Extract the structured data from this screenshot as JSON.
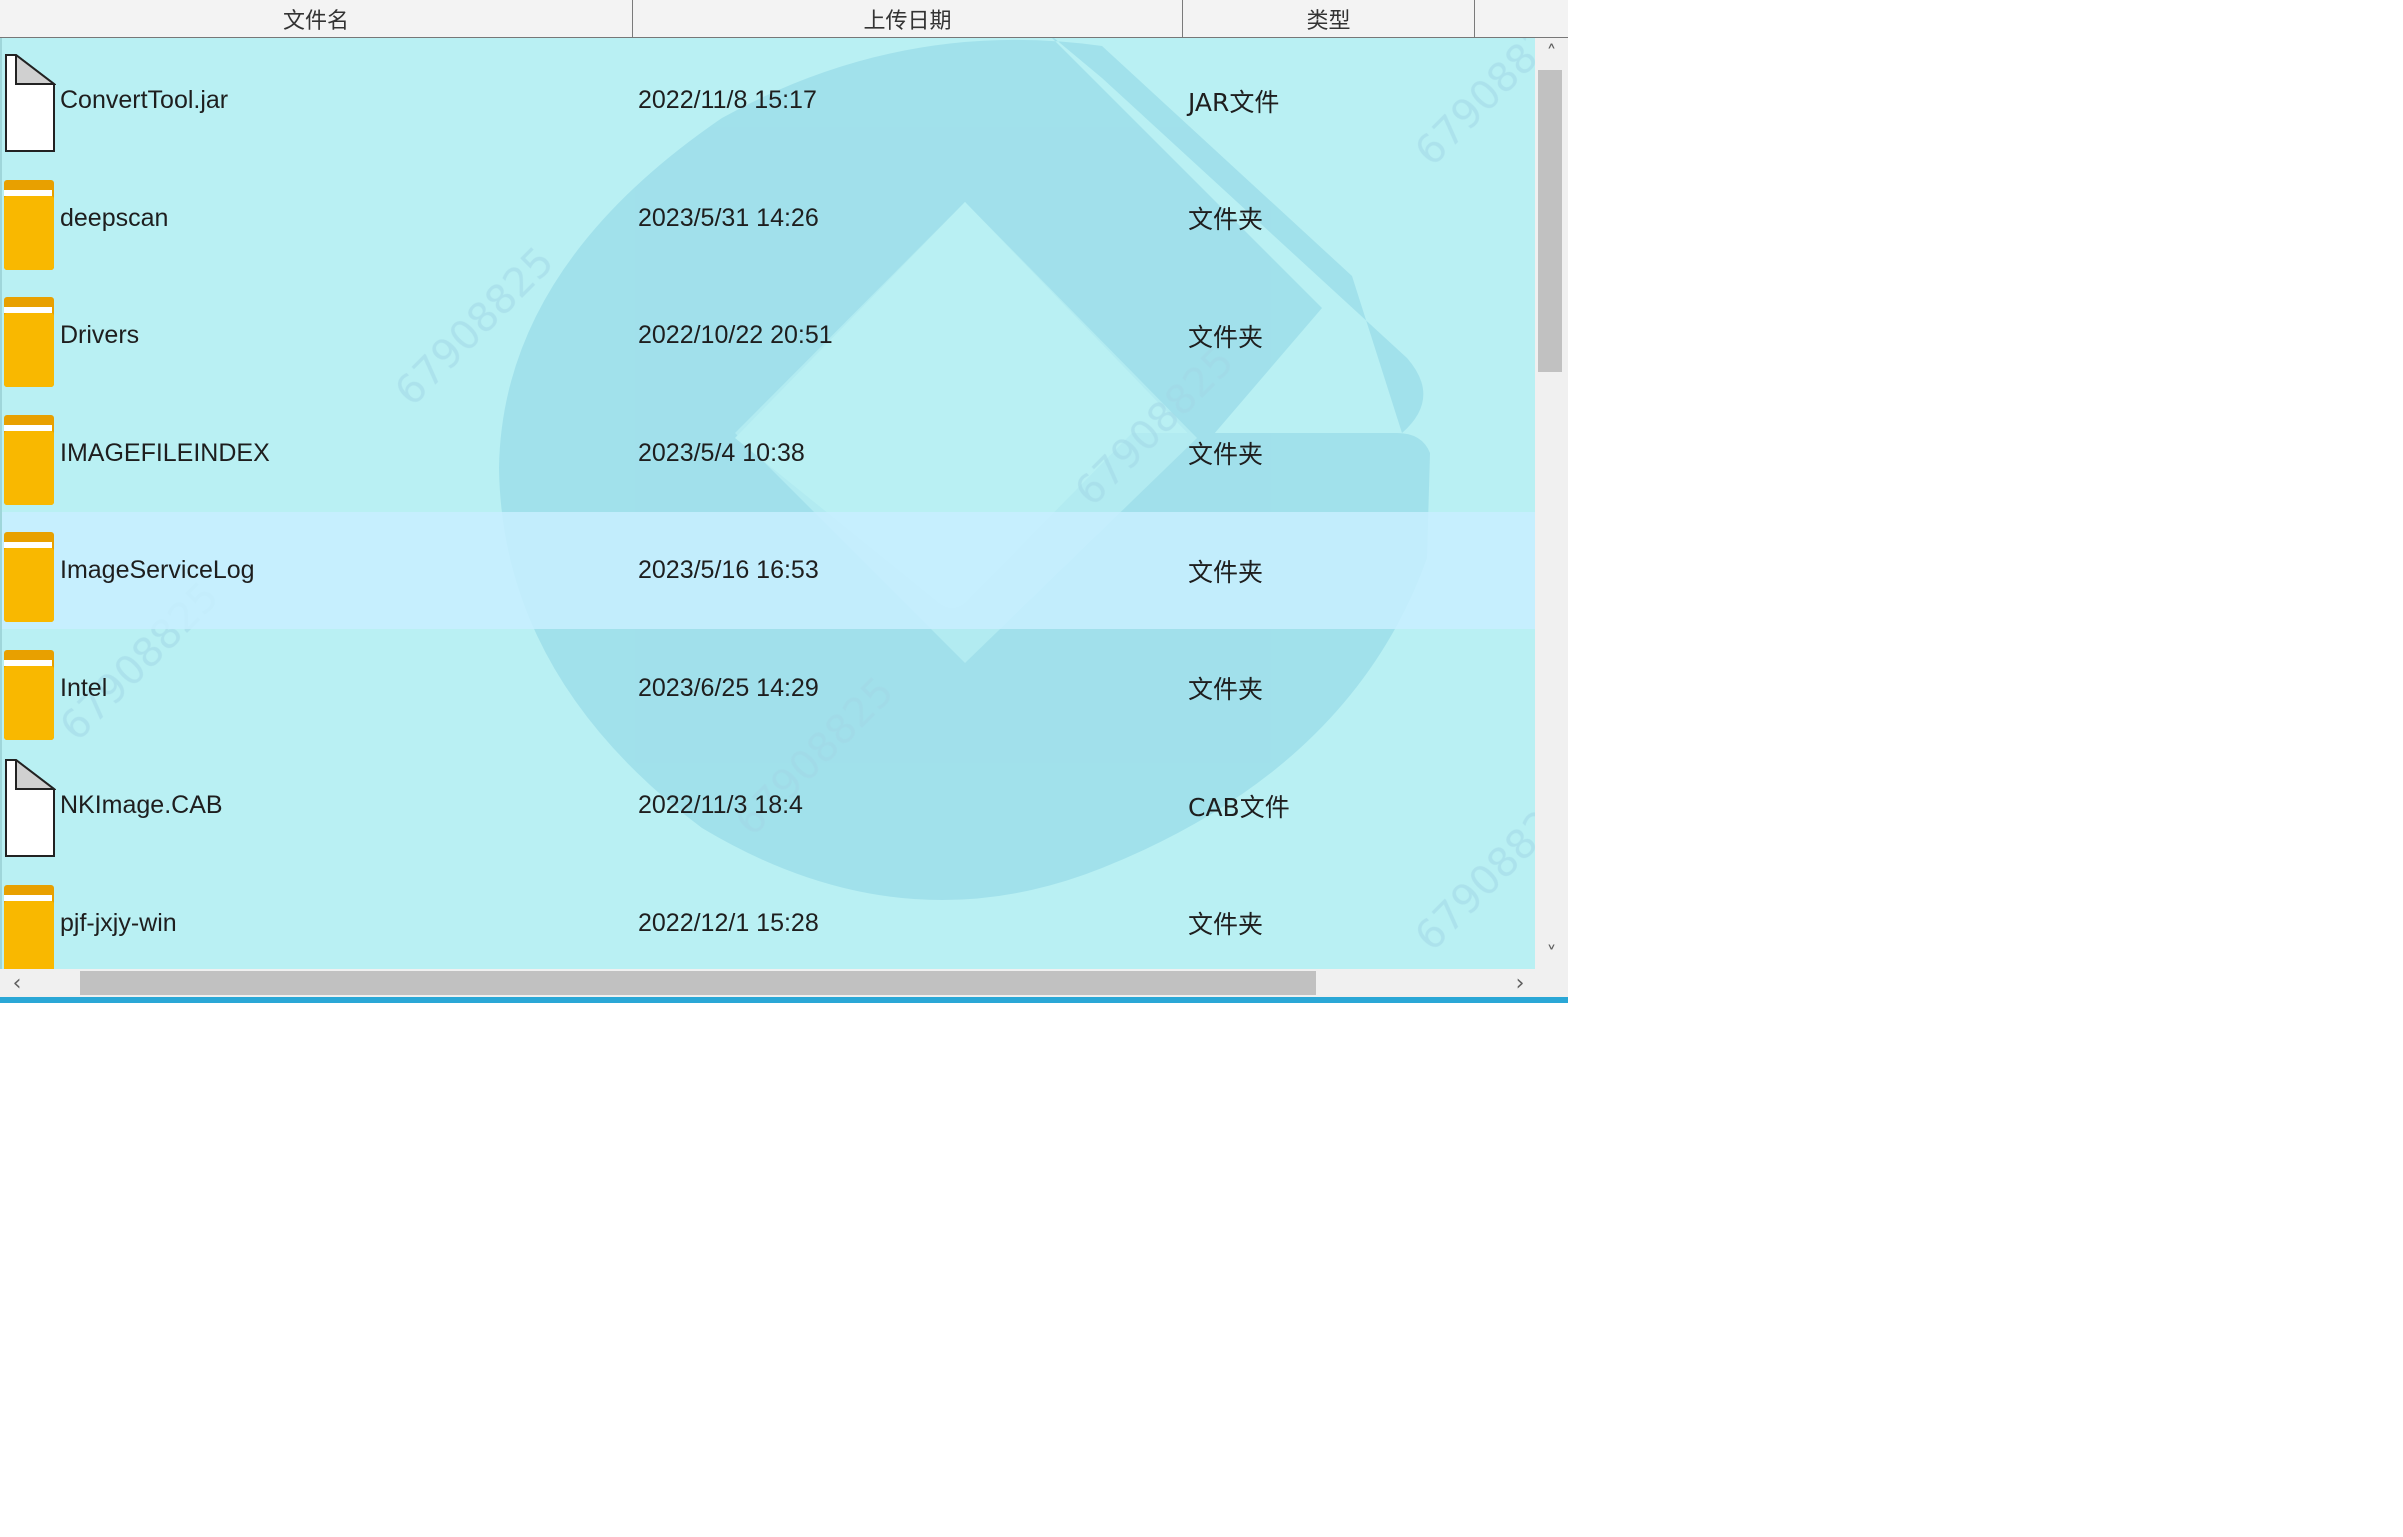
{
  "columns": {
    "name": "文件名",
    "date": "上传日期",
    "type": "类型"
  },
  "rows": [
    {
      "name": "ConvertTool.jar",
      "date": "2022/11/8 15:17",
      "type": "JAR文件",
      "icon": "file-icon"
    },
    {
      "name": "deepscan",
      "date": "2023/5/31 14:26",
      "type": "文件夹",
      "icon": "folder-icon"
    },
    {
      "name": "Drivers",
      "date": "2022/10/22 20:51",
      "type": "文件夹",
      "icon": "folder-icon"
    },
    {
      "name": "IMAGEFILEINDEX",
      "date": "2023/5/4 10:38",
      "type": "文件夹",
      "icon": "folder-icon"
    },
    {
      "name": "ImageServiceLog",
      "date": "2023/5/16 16:53",
      "type": "文件夹",
      "icon": "folder-icon",
      "selected": true
    },
    {
      "name": "Intel",
      "date": "2023/6/25 14:29",
      "type": "文件夹",
      "icon": "folder-icon"
    },
    {
      "name": "NKImage.CAB",
      "date": "2022/11/3 18:4",
      "type": "CAB文件",
      "icon": "file-icon"
    },
    {
      "name": "pjf-jxjy-win",
      "date": "2022/12/1 15:28",
      "type": "文件夹",
      "icon": "folder-icon"
    }
  ],
  "watermark": {
    "text": "67908825"
  },
  "colors": {
    "list_background": "#b9f0f3",
    "selected_row": "#c8eeff",
    "folder": "#f9b800",
    "folder_tab": "#e8a000",
    "watermark_logo": "#7cc8df",
    "accent_bar": "#2aa7d6"
  },
  "scrollbars": {
    "vertical_up": "up-arrow",
    "vertical_down": "down-arrow",
    "horizontal_left": "left-arrow",
    "horizontal_right": "right-arrow"
  }
}
